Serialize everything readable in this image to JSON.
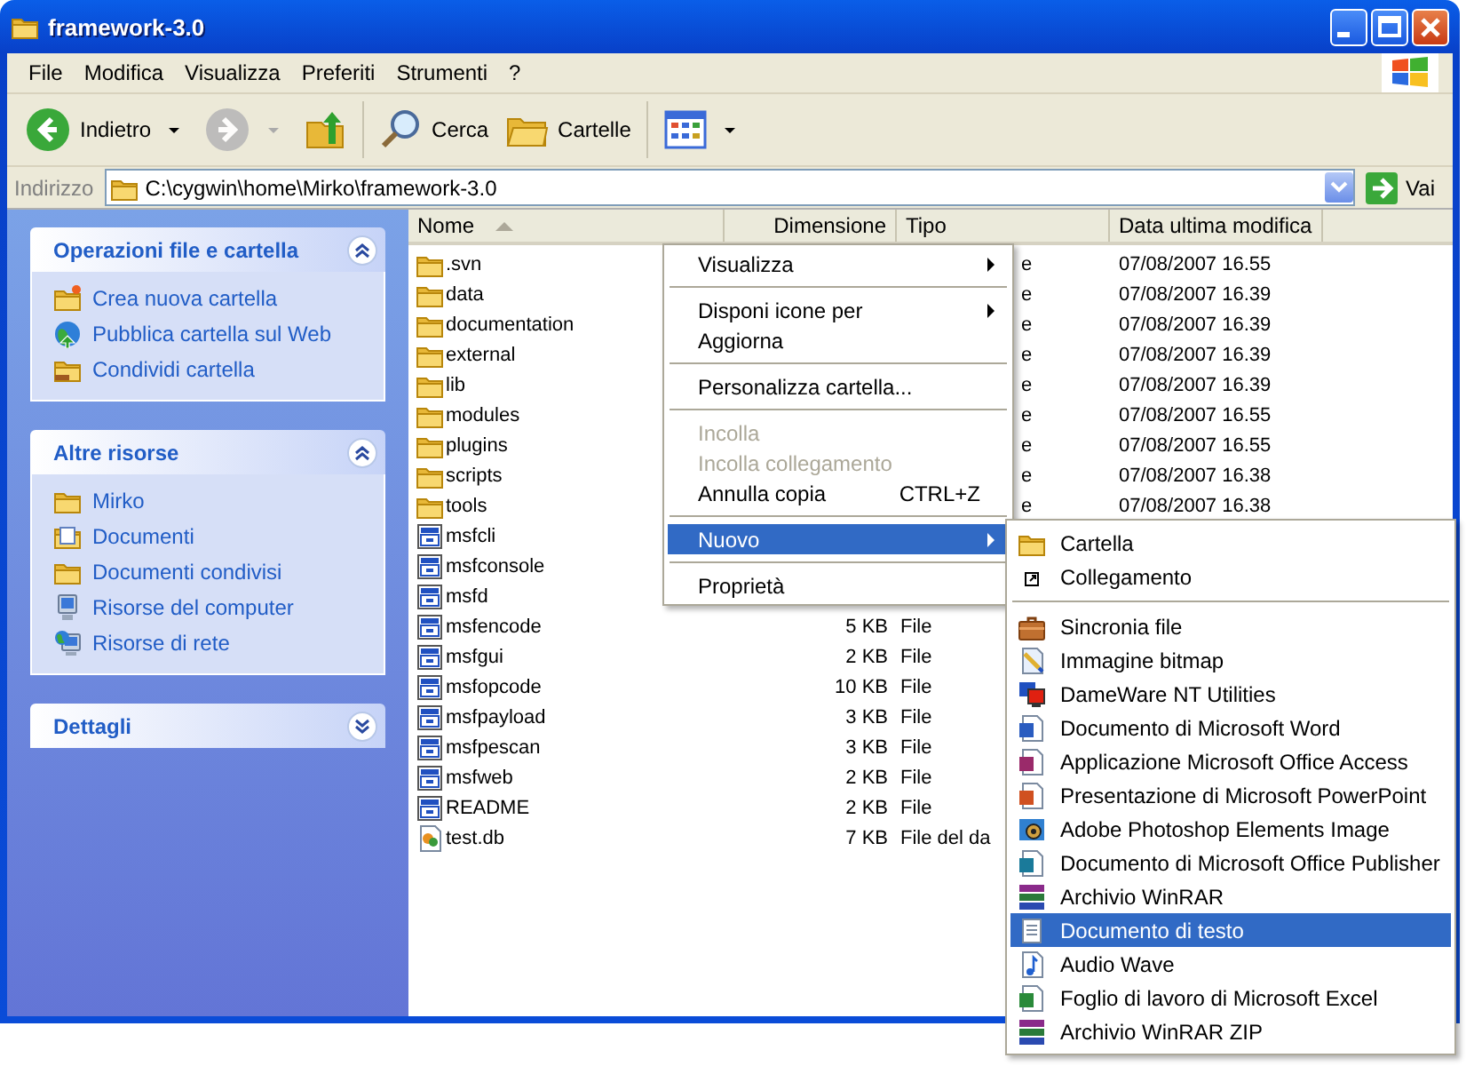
{
  "window": {
    "title": "framework-3.0"
  },
  "menu_bar": [
    "File",
    "Modifica",
    "Visualizza",
    "Preferiti",
    "Strumenti",
    "?"
  ],
  "toolbar": {
    "back": {
      "label": "Indietro",
      "disabled": false
    },
    "forward": {
      "disabled": true
    },
    "search": {
      "label": "Cerca"
    },
    "folders": {
      "label": "Cartelle"
    }
  },
  "address_bar": {
    "label": "Indirizzo",
    "value": "C:\\cygwin\\home\\Mirko\\framework-3.0",
    "go": "Vai"
  },
  "sidebar": {
    "panels": [
      {
        "title": "Operazioni file e cartella",
        "expanded": true,
        "items": [
          {
            "label": "Crea nuova cartella",
            "kind": "new-folder"
          },
          {
            "label": "Pubblica cartella sul Web",
            "kind": "globe"
          },
          {
            "label": "Condividi cartella",
            "kind": "shared-folder"
          }
        ]
      },
      {
        "title": "Altre risorse",
        "expanded": true,
        "items": [
          {
            "label": "Mirko",
            "kind": "folder"
          },
          {
            "label": "Documenti",
            "kind": "documents"
          },
          {
            "label": "Documenti condivisi",
            "kind": "folder"
          },
          {
            "label": "Risorse del computer",
            "kind": "computer"
          },
          {
            "label": "Risorse di rete",
            "kind": "network"
          }
        ]
      },
      {
        "title": "Dettagli",
        "expanded": false
      }
    ]
  },
  "file_list": {
    "columns": [
      {
        "label": "Nome",
        "sorted": true
      },
      {
        "label": "Dimensione",
        "sorted": false
      },
      {
        "label": "Tipo",
        "sorted": false
      },
      {
        "label": "Data ultima modifica",
        "sorted": false
      }
    ],
    "rows": [
      {
        "kind": "folder",
        "name": ".svn",
        "type": "e",
        "date": "07/08/2007 16.55"
      },
      {
        "kind": "folder",
        "name": "data",
        "type": "e",
        "date": "07/08/2007 16.39"
      },
      {
        "kind": "folder",
        "name": "documentation",
        "type": "e",
        "date": "07/08/2007 16.39"
      },
      {
        "kind": "folder",
        "name": "external",
        "type": "e",
        "date": "07/08/2007 16.39"
      },
      {
        "kind": "folder",
        "name": "lib",
        "type": "e",
        "date": "07/08/2007 16.39"
      },
      {
        "kind": "folder",
        "name": "modules",
        "type": "e",
        "date": "07/08/2007 16.55"
      },
      {
        "kind": "folder",
        "name": "plugins",
        "type": "e",
        "date": "07/08/2007 16.55"
      },
      {
        "kind": "folder",
        "name": "scripts",
        "type": "e",
        "date": "07/08/2007 16.38"
      },
      {
        "kind": "folder",
        "name": "tools",
        "type": "e",
        "date": "07/08/2007 16.38"
      },
      {
        "kind": "file",
        "name": "msfcli"
      },
      {
        "kind": "file",
        "name": "msfconsole"
      },
      {
        "kind": "file",
        "name": "msfd"
      },
      {
        "kind": "file",
        "name": "msfencode",
        "size": "5 KB",
        "type": "File"
      },
      {
        "kind": "file",
        "name": "msfgui",
        "size": "2 KB",
        "type": "File"
      },
      {
        "kind": "file",
        "name": "msfopcode",
        "size": "10 KB",
        "type": "File"
      },
      {
        "kind": "file",
        "name": "msfpayload",
        "size": "3 KB",
        "type": "File"
      },
      {
        "kind": "file",
        "name": "msfpescan",
        "size": "3 KB",
        "type": "File"
      },
      {
        "kind": "file",
        "name": "msfweb",
        "size": "2 KB",
        "type": "File"
      },
      {
        "kind": "file",
        "name": "README",
        "size": "2 KB",
        "type": "File"
      },
      {
        "kind": "db",
        "name": "test.db",
        "size": "7 KB",
        "type": "File del da"
      }
    ]
  },
  "context_menu": {
    "items": [
      {
        "kind": "item",
        "label": "Visualizza",
        "submenu": true,
        "disabled": false,
        "selected": false
      },
      {
        "kind": "separator"
      },
      {
        "kind": "item",
        "label": "Disponi icone per",
        "submenu": true,
        "disabled": false,
        "selected": false
      },
      {
        "kind": "item",
        "label": "Aggiorna",
        "submenu": false,
        "disabled": false,
        "selected": false
      },
      {
        "kind": "separator"
      },
      {
        "kind": "item",
        "label": "Personalizza cartella...",
        "submenu": false,
        "disabled": false,
        "selected": false
      },
      {
        "kind": "separator"
      },
      {
        "kind": "item",
        "label": "Incolla",
        "submenu": false,
        "disabled": true,
        "selected": false
      },
      {
        "kind": "item",
        "label": "Incolla collegamento",
        "submenu": false,
        "disabled": true,
        "selected": false
      },
      {
        "kind": "item",
        "label": "Annulla copia",
        "shortcut": "CTRL+Z",
        "submenu": false,
        "disabled": false,
        "selected": false
      },
      {
        "kind": "separator"
      },
      {
        "kind": "item",
        "label": "Nuovo",
        "submenu": true,
        "disabled": false,
        "selected": true
      },
      {
        "kind": "separator"
      },
      {
        "kind": "item",
        "label": "Proprietà",
        "submenu": false,
        "disabled": false,
        "selected": false
      }
    ]
  },
  "new_submenu": {
    "items": [
      {
        "kind": "folder",
        "label": "Cartella",
        "selected": false
      },
      {
        "kind": "shortcut",
        "label": "Collegamento",
        "selected": false
      },
      {
        "kind": "separator"
      },
      {
        "kind": "briefcase",
        "label": "Sincronia file",
        "selected": false
      },
      {
        "kind": "bitmap",
        "label": "Immagine bitmap",
        "selected": false
      },
      {
        "kind": "monitor",
        "label": "DameWare NT Utilities",
        "selected": false
      },
      {
        "kind": "word",
        "label": "Documento di Microsoft Word",
        "selected": false
      },
      {
        "kind": "access",
        "label": "Applicazione Microsoft Office Access",
        "selected": false
      },
      {
        "kind": "powerpoint",
        "label": "Presentazione di Microsoft PowerPoint",
        "selected": false
      },
      {
        "kind": "photo",
        "label": "Adobe Photoshop Elements Image",
        "selected": false
      },
      {
        "kind": "publisher",
        "label": "Documento di Microsoft Office Publisher",
        "selected": false
      },
      {
        "kind": "archive",
        "label": "Archivio WinRAR",
        "selected": false
      },
      {
        "kind": "text",
        "label": "Documento di testo",
        "selected": true
      },
      {
        "kind": "audio",
        "label": "Audio Wave",
        "selected": false
      },
      {
        "kind": "excel",
        "label": "Foglio di lavoro di Microsoft Excel",
        "selected": false
      },
      {
        "kind": "archive",
        "label": "Archivio WinRAR ZIP",
        "selected": false
      }
    ]
  }
}
